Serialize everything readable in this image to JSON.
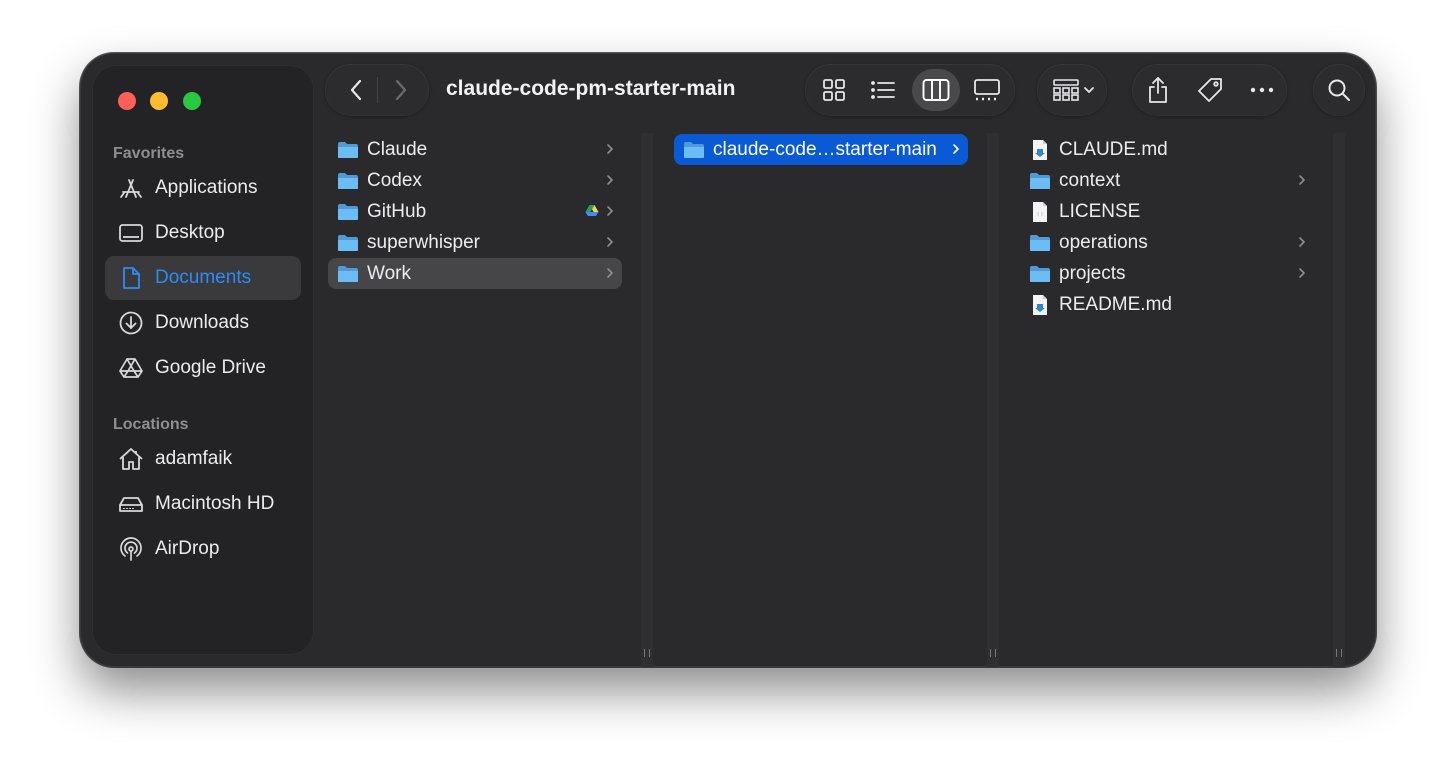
{
  "window": {
    "title": "claude-code-pm-starter-main"
  },
  "sidebar": {
    "favorites_label": "Favorites",
    "favorites": [
      {
        "label": "Applications",
        "icon": "applications-icon"
      },
      {
        "label": "Desktop",
        "icon": "desktop-icon"
      },
      {
        "label": "Documents",
        "icon": "document-icon",
        "active": true
      },
      {
        "label": "Downloads",
        "icon": "download-icon"
      },
      {
        "label": "Google Drive",
        "icon": "google-drive-icon"
      }
    ],
    "locations_label": "Locations",
    "locations": [
      {
        "label": "adamfaik",
        "icon": "home-icon"
      },
      {
        "label": "Macintosh HD",
        "icon": "hard-drive-icon"
      },
      {
        "label": "AirDrop",
        "icon": "airdrop-icon"
      }
    ]
  },
  "toolbar": {
    "back": "back-icon",
    "forward": "forward-icon",
    "views": [
      "icon-view-icon",
      "list-view-icon",
      "column-view-icon",
      "gallery-view-icon"
    ],
    "active_view": "column-view-icon",
    "group": "group-by-icon",
    "share": "share-icon",
    "tags": "tag-icon",
    "more": "more-icon",
    "search": "search-icon"
  },
  "columns": [
    {
      "items": [
        {
          "label": "Claude",
          "type": "folder",
          "chevron": true
        },
        {
          "label": "Codex",
          "type": "folder",
          "chevron": true
        },
        {
          "label": "GitHub",
          "type": "folder",
          "chevron": true,
          "badge": "google-drive-icon"
        },
        {
          "label": "superwhisper",
          "type": "folder",
          "chevron": true
        },
        {
          "label": "Work",
          "type": "folder",
          "chevron": true,
          "state": "highlighted"
        }
      ]
    },
    {
      "items": [
        {
          "label": "claude-code…starter-main",
          "type": "folder",
          "chevron": true,
          "state": "selected"
        }
      ]
    },
    {
      "items": [
        {
          "label": "CLAUDE.md",
          "type": "markdown"
        },
        {
          "label": "context",
          "type": "folder",
          "chevron": true
        },
        {
          "label": "LICENSE",
          "type": "file"
        },
        {
          "label": "operations",
          "type": "folder",
          "chevron": true
        },
        {
          "label": "projects",
          "type": "folder",
          "chevron": true
        },
        {
          "label": "README.md",
          "type": "markdown"
        }
      ]
    }
  ],
  "colors": {
    "selection": "#0a5ad6",
    "accent": "#2b8cf7",
    "folder": "#63b3f0"
  }
}
